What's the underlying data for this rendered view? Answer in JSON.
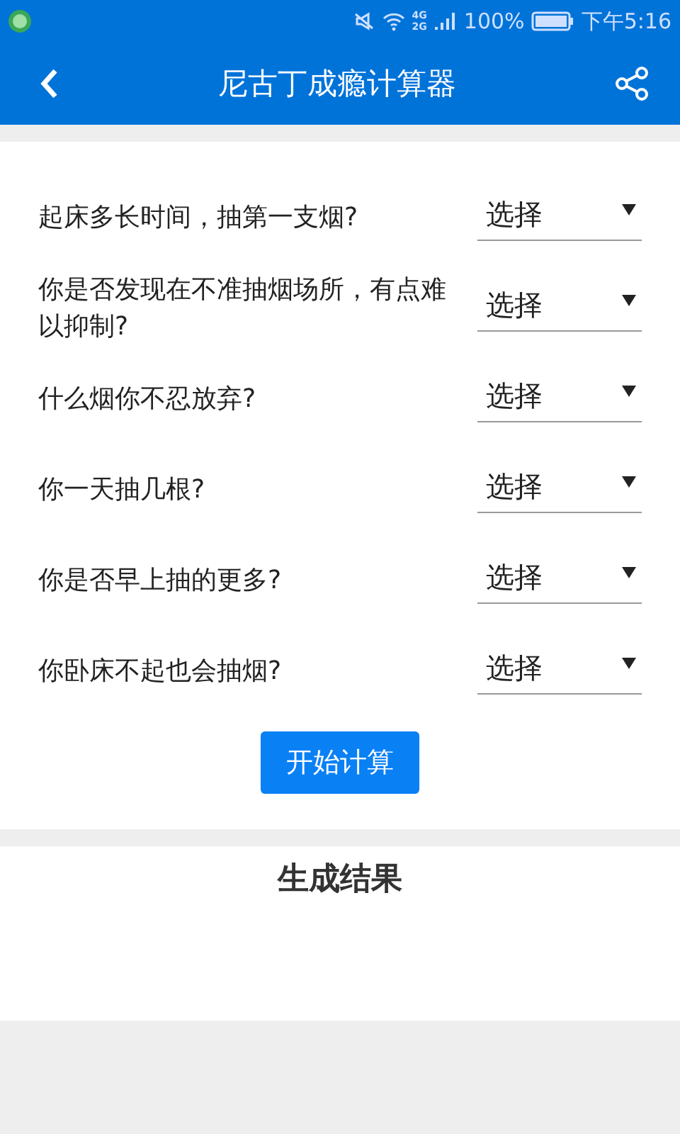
{
  "status_bar": {
    "battery_percent": "100%",
    "time": "下午5:16",
    "network_top": "4G",
    "network_bottom": "2G"
  },
  "app_bar": {
    "title": "尼古丁成瘾计算器"
  },
  "questions": [
    {
      "label": "起床多长时间，抽第一支烟?",
      "value": "选择"
    },
    {
      "label": "你是否发现在不准抽烟场所，有点难以抑制?",
      "value": "选择"
    },
    {
      "label": "什么烟你不忍放弃?",
      "value": "选择"
    },
    {
      "label": "你一天抽几根?",
      "value": "选择"
    },
    {
      "label": "你是否早上抽的更多?",
      "value": "选择"
    },
    {
      "label": "你卧床不起也会抽烟?",
      "value": "选择"
    }
  ],
  "calculate_button": "开始计算",
  "result": {
    "title": "生成结果"
  }
}
